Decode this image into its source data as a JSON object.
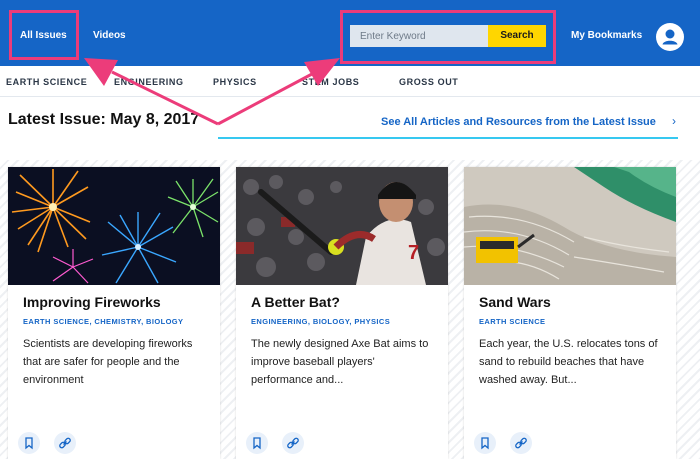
{
  "header": {
    "nav": [
      "All Issues",
      "Videos"
    ],
    "search": {
      "placeholder": "Enter Keyword",
      "button_label": "Search"
    },
    "bookmarks_label": "My Bookmarks"
  },
  "subnav": {
    "items": [
      "EARTH SCIENCE",
      "ENGINEERING",
      "PHYSICS",
      "STEM JOBS",
      "GROSS OUT"
    ]
  },
  "issue": {
    "title": "Latest Issue: May 8, 2017",
    "see_all": "See All Articles and Resources from the Latest Issue",
    "chevron": "›"
  },
  "cards": [
    {
      "title": "Improving Fireworks",
      "tags": "EARTH SCIENCE, CHEMISTRY, BIOLOGY",
      "description": "Scientists are developing fireworks that are safer for people and the environment"
    },
    {
      "title": "A Better Bat?",
      "tags": "ENGINEERING, BIOLOGY, PHYSICS",
      "description": "The newly designed Axe Bat aims to improve baseball players' performance and..."
    },
    {
      "title": "Sand Wars",
      "tags": "EARTH SCIENCE",
      "description": "Each year, the U.S. relocates tons of sand to rebuild beaches that have washed away. But..."
    }
  ],
  "colors": {
    "brand_blue": "#1565c6",
    "highlight_pink": "#ec3c7a",
    "search_yellow": "#ffd600",
    "accent_cyan": "#36c8f0"
  },
  "icons": [
    "user-icon",
    "bookmark-icon",
    "link-icon",
    "chevron-right-icon"
  ]
}
